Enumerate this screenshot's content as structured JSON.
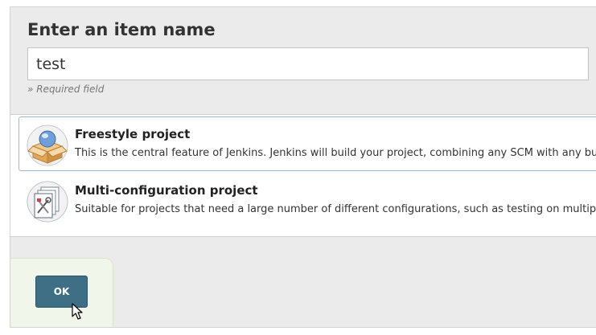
{
  "form": {
    "title": "Enter an item name",
    "name_value": "test",
    "required_hint": "» Required field"
  },
  "items": [
    {
      "icon": "freestyle-project-icon",
      "title": "Freestyle project",
      "description": "This is the central feature of Jenkins. Jenkins will build your project, combining any SCM with any build system",
      "selected": true
    },
    {
      "icon": "multi-configuration-project-icon",
      "title": "Multi-configuration project",
      "description": "Suitable for projects that need a large number of different configurations, such as testing on multiple environments",
      "selected": false
    }
  ],
  "footer": {
    "ok_label": "OK"
  },
  "colors": {
    "panel_bg": "#ebebeb",
    "ok_button_bg": "#3e6f84",
    "footer_bg": "#f0f6e9",
    "selected_border": "#9fb6cf"
  }
}
